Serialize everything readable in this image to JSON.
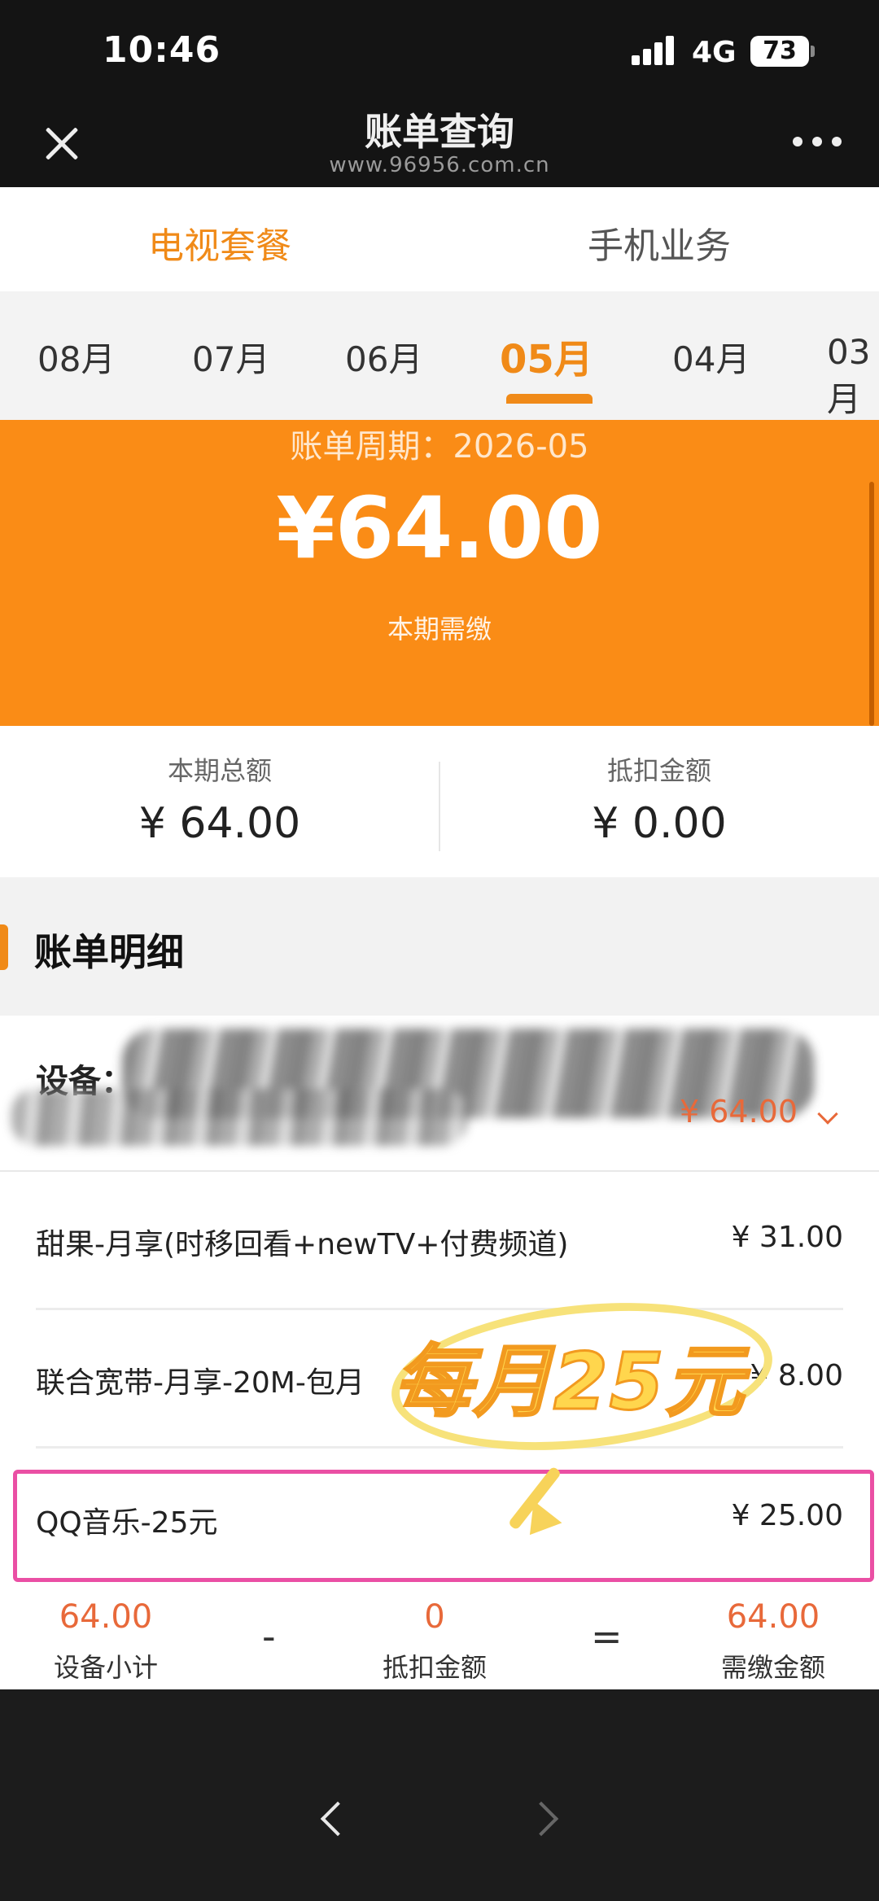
{
  "status_bar": {
    "time": "10:46",
    "network": "4G",
    "battery": "73"
  },
  "header": {
    "title": "账单查询",
    "subtitle": "www.96956.com.cn"
  },
  "tabs": [
    {
      "label": "电视套餐",
      "active": true
    },
    {
      "label": "手机业务",
      "active": false
    }
  ],
  "months": [
    {
      "label": "08月",
      "active": false
    },
    {
      "label": "07月",
      "active": false
    },
    {
      "label": "06月",
      "active": false
    },
    {
      "label": "05月",
      "active": true
    },
    {
      "label": "04月",
      "active": false
    },
    {
      "label": "03月",
      "active": false
    }
  ],
  "summary": {
    "period_text": "账单周期：2026-05",
    "amount": "¥64.00",
    "amount_label": "本期需缴",
    "total_label": "本期总额",
    "total_value": "¥ 64.00",
    "deduct_label": "抵扣金额",
    "deduct_value": "¥ 0.00"
  },
  "detail": {
    "section_title": "账单明细",
    "device_label": "设备：",
    "device_amount": "¥ 64.00",
    "items": [
      {
        "name": "甜果-月享(时移回看+newTV+付费频道)",
        "price": "¥ 31.00"
      },
      {
        "name": "联合宽带-月享-20M-包月",
        "price": "¥ 8.00"
      },
      {
        "name": "QQ音乐-25元",
        "price": "¥ 25.00"
      }
    ],
    "promo_sticker": "每月25元",
    "calc": {
      "subtotal_value": "64.00",
      "subtotal_label": "设备小计",
      "minus": "-",
      "deduct_value": "0",
      "deduct_label": "抵扣金额",
      "equals": "=",
      "due_value": "64.00",
      "due_label": "需缴金额"
    }
  },
  "colors": {
    "accent": "#f08a18",
    "hero_bg": "#fa8c16",
    "amount_red": "#e8693a",
    "highlight_pink": "#ea4fa4"
  },
  "icons": [
    "close-icon",
    "more-icon",
    "signal-icon",
    "battery-icon",
    "chevron-down-icon",
    "back-arrow-icon",
    "forward-arrow-icon"
  ]
}
